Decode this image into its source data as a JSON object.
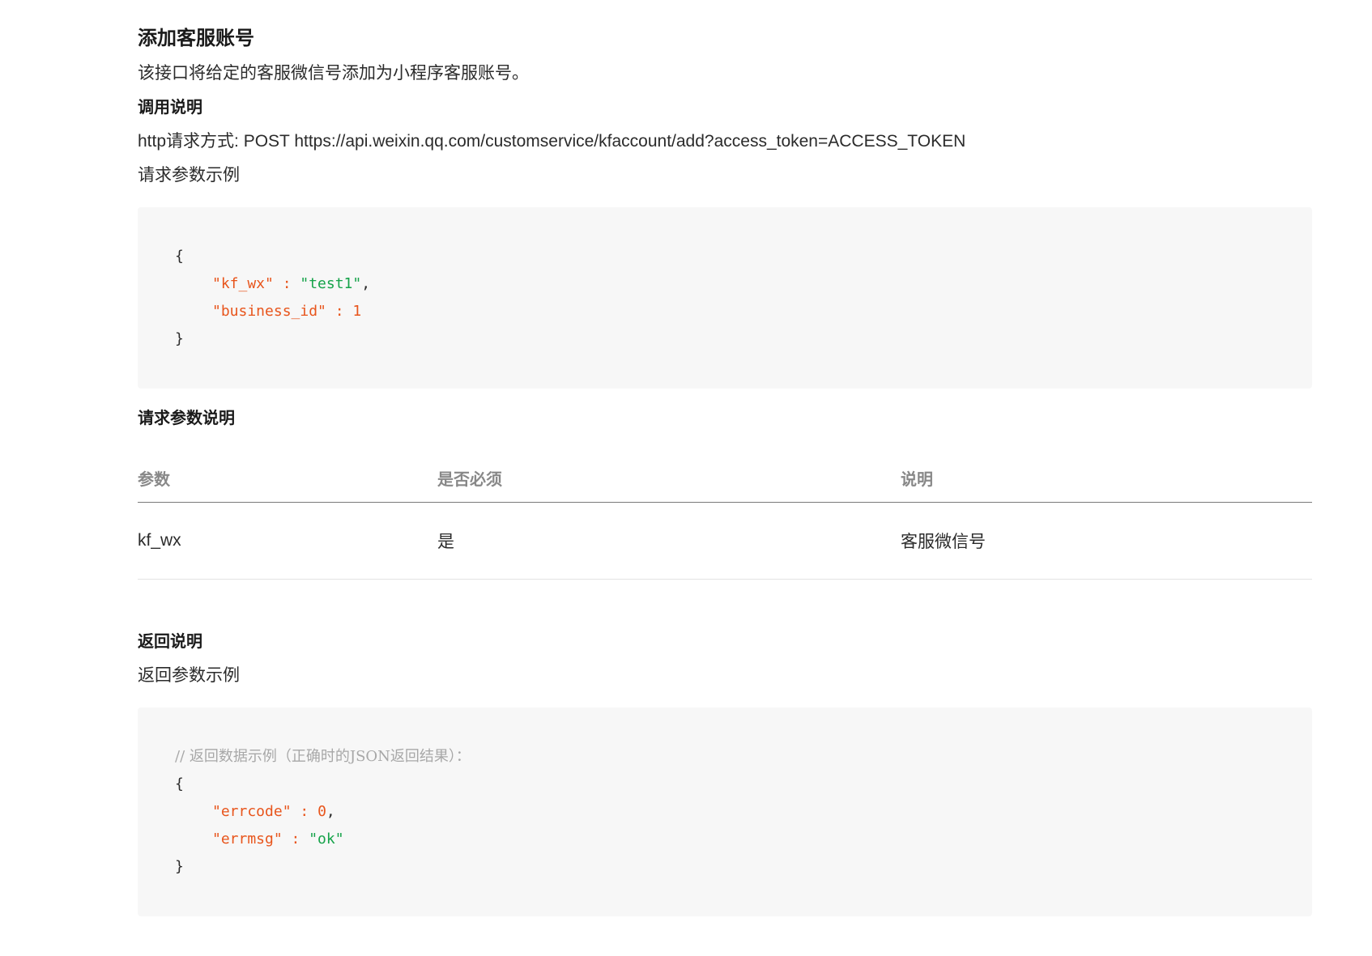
{
  "title": "添加客服账号",
  "description": "该接口将给定的客服微信号添加为小程序客服账号。",
  "call_section": {
    "heading": "调用说明",
    "http_line": "http请求方式: POST https://api.weixin.qq.com/customservice/kfaccount/add?access_token=ACCESS_TOKEN",
    "example_label": "请求参数示例"
  },
  "request_example": {
    "open": "{",
    "line1_key": "\"kf_wx\"",
    "line1_sep": " : ",
    "line1_val": "\"test1\"",
    "line1_end": ",",
    "line2_key": "\"business_id\"",
    "line2_sep": " : ",
    "line2_val": "1",
    "close": "}"
  },
  "params_section": {
    "heading": "请求参数说明",
    "columns": [
      "参数",
      "是否必须",
      "说明"
    ],
    "rows": [
      [
        "kf_wx",
        "是",
        "客服微信号"
      ]
    ]
  },
  "return_section": {
    "heading": "返回说明",
    "example_label": "返回参数示例"
  },
  "response_example": {
    "comment": "// 返回数据示例（正确时的JSON返回结果）：",
    "open": "{",
    "line1_key": "\"errcode\"",
    "line1_sep": " : ",
    "line1_val": "0",
    "line1_end": ",",
    "line2_key": "\"errmsg\"",
    "line2_sep": " : ",
    "line2_val": "\"ok\"",
    "close": "}"
  },
  "colors": {
    "key": "#e8551c",
    "string": "#16a34a",
    "comment": "#a8a8a8",
    "code_bg": "#f7f7f7"
  }
}
